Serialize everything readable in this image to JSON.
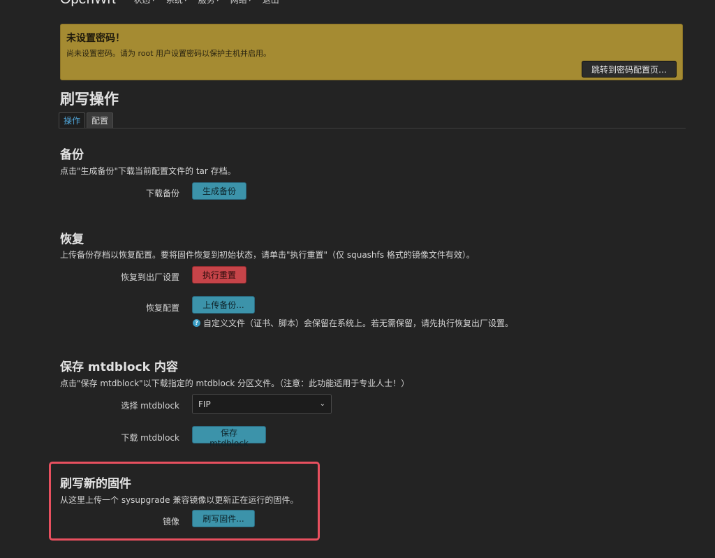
{
  "nav": {
    "brand": "OpenWrt",
    "items": [
      {
        "label": "状态"
      },
      {
        "label": "系统"
      },
      {
        "label": "服务"
      },
      {
        "label": "网络"
      },
      {
        "label": "退出"
      }
    ]
  },
  "alert": {
    "title": "未设置密码！",
    "text": "尚未设置密码。请为 root 用户设置密码以保护主机并启用。",
    "button": "跳转到密码配置页…"
  },
  "page": {
    "title": "刷写操作",
    "tabs": [
      {
        "label": "操作",
        "active": true
      },
      {
        "label": "配置",
        "active": false
      }
    ]
  },
  "backup": {
    "title": "备份",
    "desc": "点击\"生成备份\"下载当前配置文件的 tar 存档。",
    "download_label": "下载备份",
    "generate_button": "生成备份"
  },
  "restore": {
    "title": "恢复",
    "desc": "上传备份存档以恢复配置。要将固件恢复到初始状态，请单击\"执行重置\"（仅 squashfs 格式的镜像文件有效）。",
    "factory_label": "恢复到出厂设置",
    "reset_button": "执行重置",
    "restore_label": "恢复配置",
    "upload_button": "上传备份...",
    "hint": "自定义文件（证书、脚本）会保留在系统上。若无需保留，请先执行恢复出厂设置。"
  },
  "mtdblock": {
    "title": "保存 mtdblock 内容",
    "desc": "点击\"保存 mtdblock\"以下载指定的 mtdblock 分区文件。（注意：此功能适用于专业人士！）",
    "select_label": "选择 mtdblock",
    "select_value": "FIP",
    "download_label": "下载 mtdblock",
    "save_button": "保存 mtdblock"
  },
  "flash": {
    "title": "刷写新的固件",
    "desc": "从这里上传一个 sysupgrade 兼容镜像以更新正在运行的固件。",
    "image_label": "镜像",
    "flash_button": "刷写固件..."
  },
  "colors": {
    "background": "#232323",
    "alert": "#a58b32",
    "primary_button": "#3c93aa",
    "danger_button": "#c64449",
    "highlight_border": "#e8505f"
  }
}
